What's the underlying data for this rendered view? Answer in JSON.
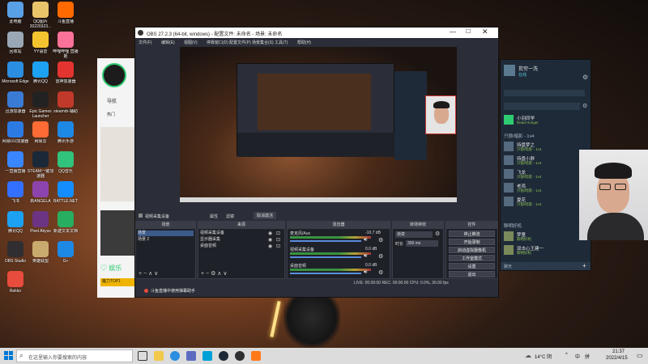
{
  "desktop": {
    "icons": [
      {
        "label": "此电脑",
        "color": "#5aa0e6"
      },
      {
        "label": "QQ图片20220323...",
        "color": "#e9c46a"
      },
      {
        "label": "斗鱼直播",
        "color": "#ff6a00"
      },
      {
        "label": "回收站",
        "color": "#9aa8b5"
      },
      {
        "label": "YY语音",
        "color": "#f4c430"
      },
      {
        "label": "哔哩哔哩 直播姬",
        "color": "#fb7299"
      },
      {
        "label": "Microsoft Edge",
        "color": "#2b8ee0"
      },
      {
        "label": "腾讯QQ",
        "color": "#1da1f2"
      },
      {
        "label": "雷神加速器",
        "color": "#e3342f"
      },
      {
        "label": "迅游加速器",
        "color": "#3a7bd5"
      },
      {
        "label": "Epic Games Launcher",
        "color": "#222222"
      },
      {
        "label": "steamrb-辅助",
        "color": "#c0392b"
      },
      {
        "label": "网易UU加速器",
        "color": "#2c7be5"
      },
      {
        "label": "网易云",
        "color": "#ff6b35"
      },
      {
        "label": "腾讯手游",
        "color": "#1e88e5"
      },
      {
        "label": "一直播直播",
        "color": "#3a86ff"
      },
      {
        "label": "STEAM一键加速器",
        "color": "#1b2838"
      },
      {
        "label": "QQ音乐",
        "color": "#31c27c"
      },
      {
        "label": "飞书",
        "color": "#3370ff"
      },
      {
        "label": "新ANGELA",
        "color": "#8e44ad"
      },
      {
        "label": "BATTLE.NET",
        "color": "#148eff"
      },
      {
        "label": "腾讯QQ",
        "color": "#1da1f2"
      },
      {
        "label": "Pixel Abyss",
        "color": "#6c3483"
      },
      {
        "label": "新建文本文档",
        "color": "#27ae60"
      },
      {
        "label": "OBS Studio",
        "color": "#302e31"
      },
      {
        "label": "英雄联盟",
        "color": "#c8aa6e"
      },
      {
        "label": "G+",
        "color": "#1e88e5"
      },
      {
        "label": "Rekko",
        "color": "#e74c3c"
      }
    ]
  },
  "obs": {
    "title": "OBS 27.2.3 (64-bit, windows) - 配置文件: 未命名 - 场景: 未命名",
    "menu": [
      "文件(F)",
      "编辑(E)",
      "视图(V)",
      "停靠窗口(D)",
      "配置文件(P)",
      "场景集合(S)",
      "工具(T)",
      "帮助(H)"
    ],
    "source_toolbar": {
      "source_name": "视频采集设备",
      "props": "属性",
      "filters": "滤镜",
      "deactivate": "取消激活"
    },
    "panels": {
      "scenes": {
        "title": "场景",
        "items": [
          "场景",
          "场景 2"
        ]
      },
      "sources": {
        "title": "来源",
        "items": [
          "视频采集设备",
          "显示器采集",
          "桌面音频"
        ]
      },
      "mixer": {
        "title": "混音器",
        "tracks": [
          {
            "name": "麦克风/Aux",
            "db": "-10.7 dB"
          },
          {
            "name": "视频采集设备",
            "db": "0.0 dB"
          },
          {
            "name": "桌面音频",
            "db": "0.0 dB"
          }
        ]
      },
      "transitions": {
        "title": "转场特效",
        "type": "渐变",
        "duration_label": "时长",
        "duration": "300 ms"
      },
      "controls": {
        "title": "控件",
        "buttons": [
          "停止推流",
          "开始录制",
          "启动虚拟摄像机",
          "工作室模式",
          "设置",
          "退出"
        ]
      }
    },
    "status": "LIVE: 00:00:00   REC: 00:00:00   CPU: 0.0%, 30.00 fps",
    "notice": "斗鱼直播中使用弹幕助手"
  },
  "steam": {
    "user": {
      "name": "贫穷一洗",
      "status": "在线"
    },
    "search_placeholder": "",
    "section_game": "只狼/暗影 - 1v4",
    "featured": {
      "name": "小羽同学",
      "status": "Dead Hunger"
    },
    "friends": [
      {
        "name": "持盘梦之",
        "status": "只狼/暗影 - 1v4"
      },
      {
        "name": "持盘小胖",
        "status": "只狼/暗影 - 1v4"
      },
      {
        "name": "飞龙",
        "status": "只狼/暗影 - 1v4"
      },
      {
        "name": "老鸡",
        "status": "只狼/暗影 - 1v4"
      },
      {
        "name": "夏花",
        "status": "只狼/暗影 - 1v4"
      }
    ],
    "section_online": "聊明好机",
    "online": [
      {
        "name": "梦童",
        "status": "聊明好机"
      },
      {
        "name": "双击心王建一",
        "status": "聊明好机"
      }
    ],
    "chat_label": "聊天"
  },
  "taskbar": {
    "search_placeholder": "在这里输入你要搜索的内容",
    "weather": "14°C 阴",
    "time": "21:37",
    "date": "2022/4/15",
    "tray": [
      "^",
      "中",
      "拼"
    ]
  },
  "colors": {
    "obs_bg": "#2b2e38",
    "steam_bg": "#1e2a38",
    "live_red": "#c93a3a",
    "taskbar": "#dcdcdc"
  }
}
